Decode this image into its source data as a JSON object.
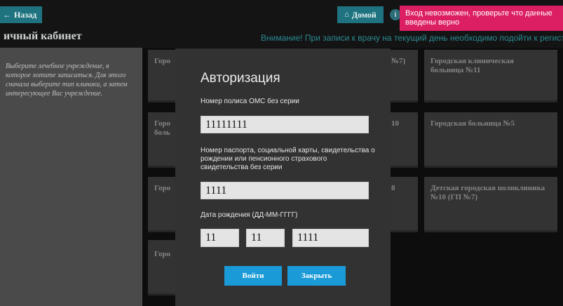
{
  "header": {
    "back_label": "Назад",
    "home_label": "Домой",
    "info_icon": "info-icon",
    "alert_text": "Вход невозможен, проверьте что данные введены верно",
    "alert_color": "#dc1f63",
    "accent_color": "#1f7380"
  },
  "page": {
    "title": "ичный кабинет",
    "notice": "Внимание! При записи к врачу на текущий день необходимо подойти к регистратуре"
  },
  "sidebar": {
    "text": "Выберите лечебное учреждение, в которое хотите записаться. Для этого сначала выберите тип клиники, а затем интересующее Вас учреждение."
  },
  "cards": {
    "c1": "Горо",
    "c2": "Горо\nболь",
    "c3": "Горо",
    "c4": "Горо",
    "c5": "№7)",
    "c6": "10",
    "c7": "8",
    "c8": "Городская клиническая больница №11",
    "c9": "Городская больница №5",
    "c10": "Детская городская поликлиника №10 (ГП №7)"
  },
  "modal": {
    "title": "Авторизация",
    "polis_label": "Номер полиса ОМС без серии",
    "polis_value": "11111111",
    "doc_label": "Номер паспорта, социальной карты, свидетельства о рождении или пенсионного страхового свидетельства без серии",
    "doc_value": "1111",
    "dob_label": "Дата рождения (ДД-ММ-ГГГГ)",
    "dob_day": "11",
    "dob_month": "11",
    "dob_year": "1111",
    "login_label": "Войти",
    "close_label": "Закрыть",
    "button_color": "#1a9bd7"
  }
}
